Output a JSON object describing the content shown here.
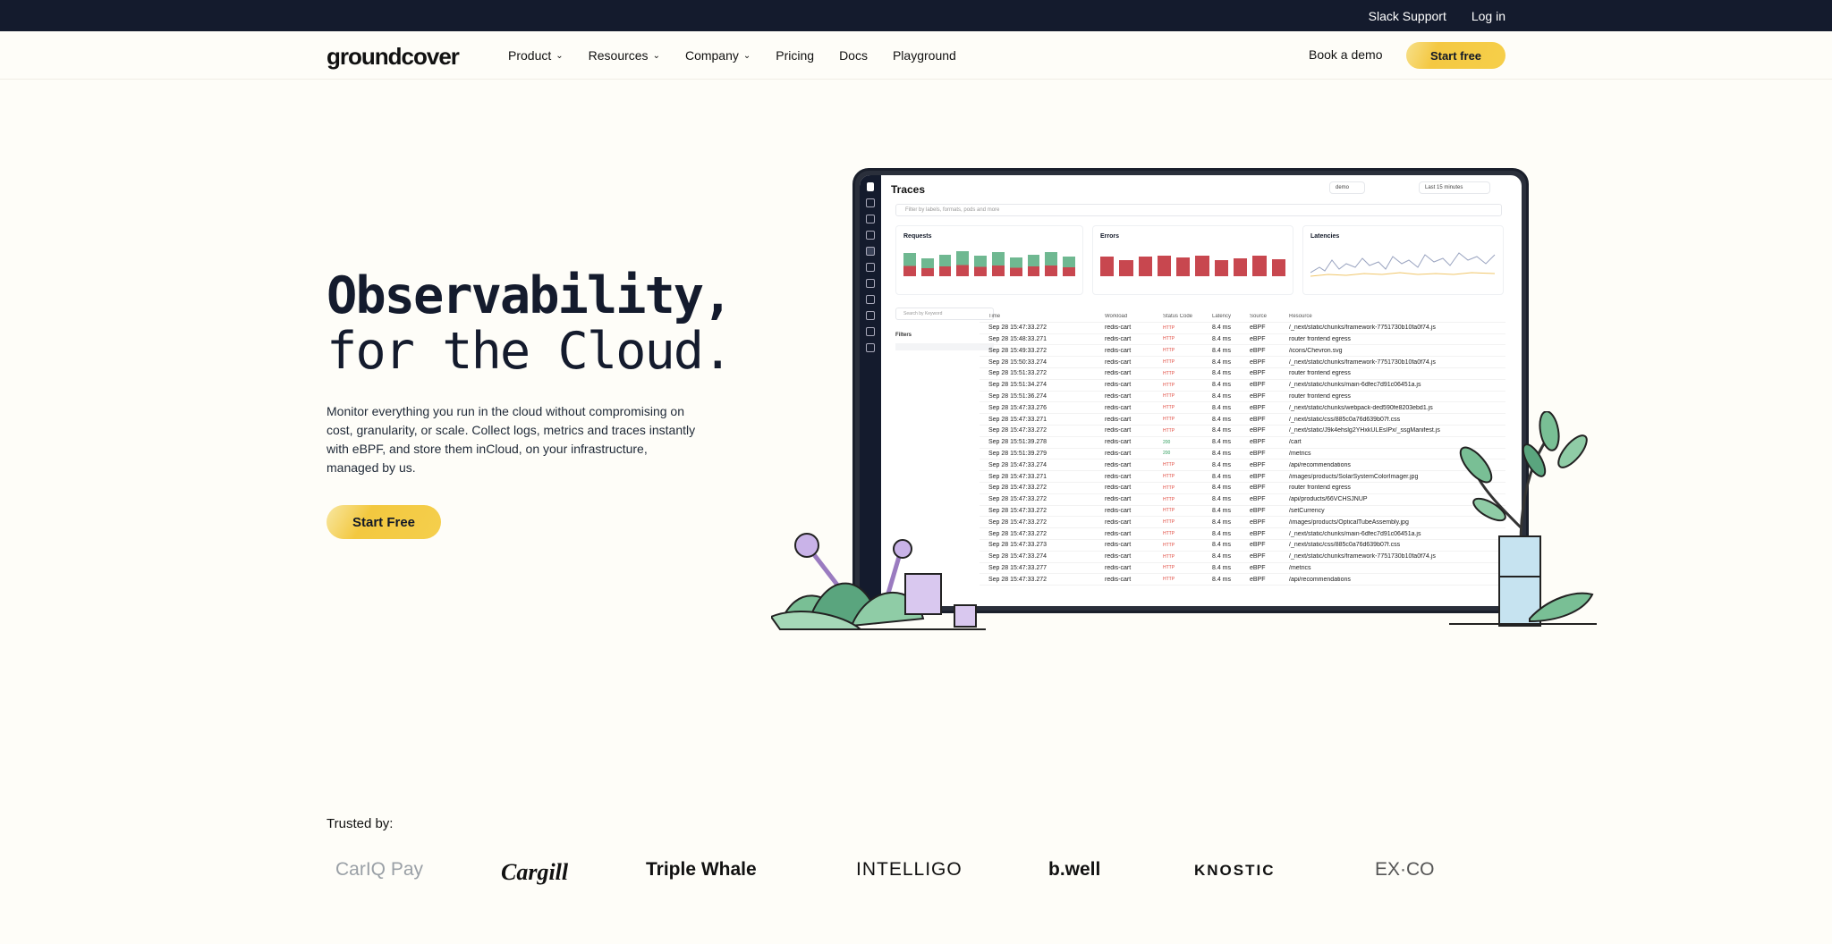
{
  "topbar": {
    "links": [
      "Slack Support",
      "Log in"
    ]
  },
  "nav": {
    "logo": "groundcover",
    "menu": [
      "Product",
      "Resources",
      "Company",
      "Pricing",
      "Docs",
      "Playground"
    ],
    "book_demo": "Book a demo",
    "start_free": "Start free"
  },
  "hero": {
    "title_line1": "Observability,",
    "title_line2": "for the Cloud.",
    "description": "Monitor everything you run in the cloud without compromising on cost, granularity, or scale. Collect logs, metrics and traces instantly with eBPF, and store them inCloud, on your infrastructure, managed by us.",
    "cta": "Start Free"
  },
  "dashboard": {
    "title": "Traces",
    "search_placeholder": "Filter by labels, formats, pods and more",
    "env": "demo",
    "range": "Last 15 minutes",
    "cards": [
      "Requests",
      "Errors",
      "Latencies"
    ],
    "filters_search": "Search by Keyword",
    "filters_title": "Filters",
    "columns": [
      "Time",
      "Workload",
      "Status Code",
      "Latency",
      "Source",
      "Resource"
    ],
    "rows": [
      [
        "Sep 28 15:47:33.272",
        "redis-cart",
        "HTTP",
        "8.4 ms",
        "eBPF",
        "/_next/static/chunks/framework-7751730b10fa0f74.js"
      ],
      [
        "Sep 28 15:48:33.271",
        "redis-cart",
        "HTTP",
        "8.4 ms",
        "eBPF",
        "router frontend egress"
      ],
      [
        "Sep 28 15:49:33.272",
        "redis-cart",
        "HTTP",
        "8.4 ms",
        "eBPF",
        "/icons/Chevron.svg"
      ],
      [
        "Sep 28 15:50:33.274",
        "redis-cart",
        "HTTP",
        "8.4 ms",
        "eBPF",
        "/_next/static/chunks/framework-7751730b10fa0f74.js"
      ],
      [
        "Sep 28 15:51:33.272",
        "redis-cart",
        "HTTP",
        "8.4 ms",
        "eBPF",
        "router frontend egress"
      ],
      [
        "Sep 28 15:51:34.274",
        "redis-cart",
        "HTTP",
        "8.4 ms",
        "eBPF",
        "/_next/static/chunks/main-6dfec7d91c06451a.js"
      ],
      [
        "Sep 28 15:51:36.274",
        "redis-cart",
        "HTTP",
        "8.4 ms",
        "eBPF",
        "router frontend egress"
      ],
      [
        "Sep 28 15:47:33.276",
        "redis-cart",
        "HTTP",
        "8.4 ms",
        "eBPF",
        "/_next/static/chunks/webpack-ded590fe8203ebd1.js"
      ],
      [
        "Sep 28 15:47:33.271",
        "redis-cart",
        "HTTP",
        "8.4 ms",
        "eBPF",
        "/_next/static/css/885c0a76d639b07f.css"
      ],
      [
        "Sep 28 15:47:33.272",
        "redis-cart",
        "HTTP",
        "8.4 ms",
        "eBPF",
        "/_next/static/J9k4ehslg2YHxkULEsIPx/_ssgManifest.js"
      ],
      [
        "Sep 28 15:51:39.278",
        "redis-cart",
        "200",
        "8.4 ms",
        "eBPF",
        "/cart"
      ],
      [
        "Sep 28 15:51:39.279",
        "redis-cart",
        "200",
        "8.4 ms",
        "eBPF",
        "/metrics"
      ],
      [
        "Sep 28 15:47:33.274",
        "redis-cart",
        "HTTP",
        "8.4 ms",
        "eBPF",
        "/api/recommendations"
      ],
      [
        "Sep 28 15:47:33.271",
        "redis-cart",
        "HTTP",
        "8.4 ms",
        "eBPF",
        "/images/products/SolarSystemColorImager.jpg"
      ],
      [
        "Sep 28 15:47:33.272",
        "redis-cart",
        "HTTP",
        "8.4 ms",
        "eBPF",
        "router frontend egress"
      ],
      [
        "Sep 28 15:47:33.272",
        "redis-cart",
        "HTTP",
        "8.4 ms",
        "eBPF",
        "/api/products/66VCHSJNUP"
      ],
      [
        "Sep 28 15:47:33.272",
        "redis-cart",
        "HTTP",
        "8.4 ms",
        "eBPF",
        "/setCurrency"
      ],
      [
        "Sep 28 15:47:33.272",
        "redis-cart",
        "HTTP",
        "8.4 ms",
        "eBPF",
        "/images/products/OpticalTubeAssembly.jpg"
      ],
      [
        "Sep 28 15:47:33.272",
        "redis-cart",
        "HTTP",
        "8.4 ms",
        "eBPF",
        "/_next/static/chunks/main-6dfec7d91c06451a.js"
      ],
      [
        "Sep 28 15:47:33.273",
        "redis-cart",
        "HTTP",
        "8.4 ms",
        "eBPF",
        "/_next/static/css/885c0a76d639b07f.css"
      ],
      [
        "Sep 28 15:47:33.274",
        "redis-cart",
        "HTTP",
        "8.4 ms",
        "eBPF",
        "/_next/static/chunks/framework-7751730b10fa0f74.js"
      ],
      [
        "Sep 28 15:47:33.277",
        "redis-cart",
        "HTTP",
        "8.4 ms",
        "eBPF",
        "/metrics"
      ],
      [
        "Sep 28 15:47:33.272",
        "redis-cart",
        "HTTP",
        "8.4 ms",
        "eBPF",
        "/api/recommendations"
      ]
    ]
  },
  "trusted": {
    "label": "Trusted by:",
    "logos": [
      "CarIQ Pay",
      "Cargill",
      "Triple Whale",
      "INTELLIGO",
      "b.well",
      "KNOSTIC",
      "EX·CO"
    ]
  }
}
